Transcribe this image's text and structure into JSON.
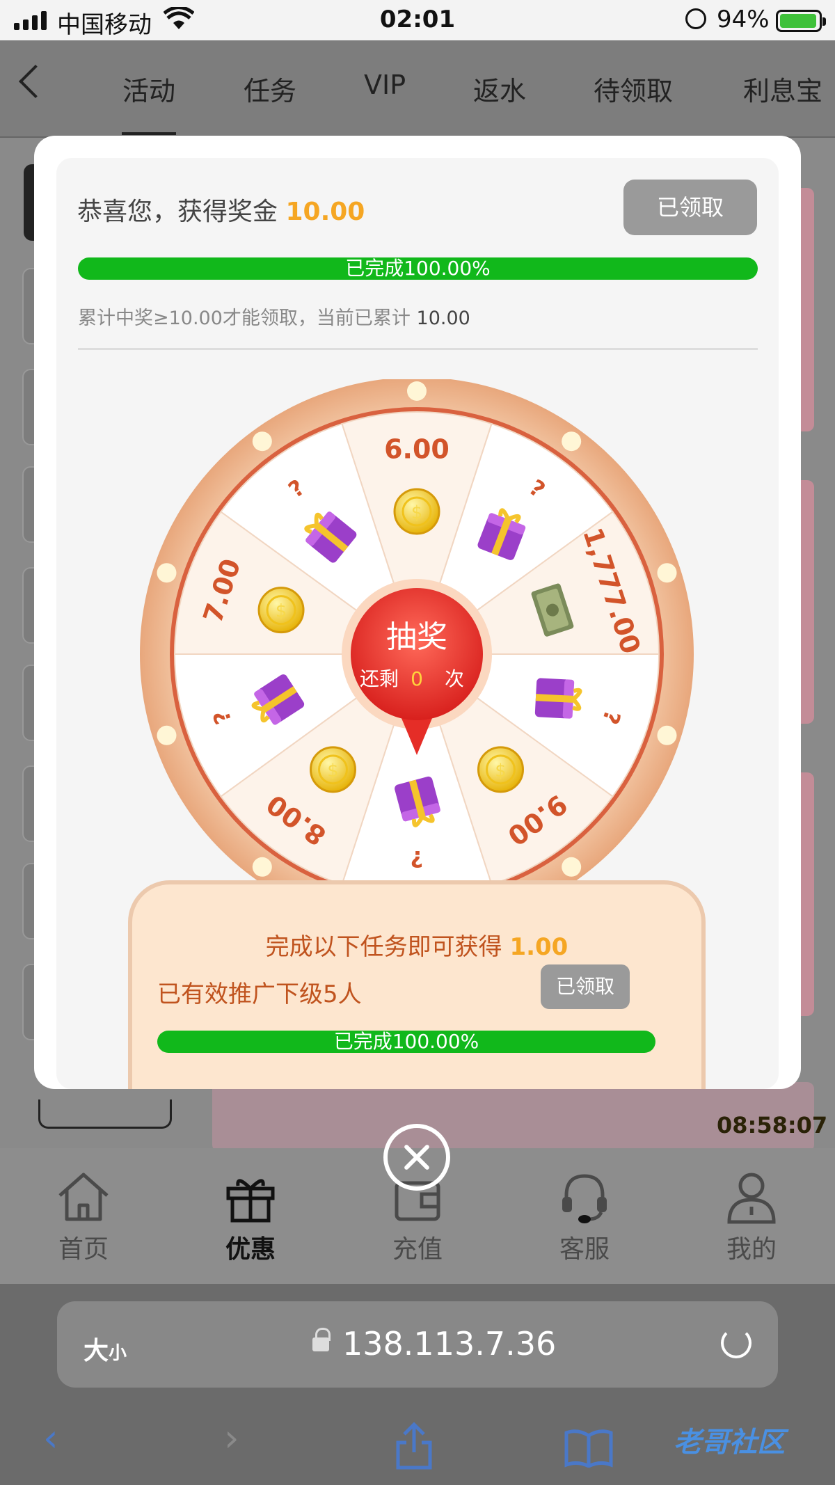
{
  "status_bar": {
    "carrier": "中国移动",
    "time": "02:01",
    "battery": "94%"
  },
  "top_tabs": {
    "items": [
      "活动",
      "任务",
      "VIP",
      "返水",
      "待领取",
      "利息宝"
    ],
    "active": "活动"
  },
  "background": {
    "countdown": "08:58:07"
  },
  "modal": {
    "reward_prefix": "恭喜您，获得奖金",
    "reward_amount": "10.00",
    "claim_button": "已领取",
    "progress_text": "已完成100.00%",
    "progress_fraction": 1.0,
    "accum_text": "累计中奖≥10.00才能领取，当前已累计",
    "accum_value": "10.00",
    "wheel": {
      "center_title": "抽奖",
      "remaining_prefix": "还剩",
      "remaining_count": "0",
      "remaining_suffix": "次",
      "segments": [
        "6.00",
        "?",
        "1,777.00",
        "?",
        "9.00",
        "?",
        "8.00",
        "?",
        "7.00",
        "?"
      ]
    },
    "task_panel": {
      "title_prefix": "完成以下任务即可获得",
      "title_amount": "1.00",
      "task_label": "已有效推广下级5人",
      "task_button": "已领取",
      "progress_text": "已完成100.00%",
      "progress_fraction": 1.0
    }
  },
  "bottom_nav": [
    {
      "label": "首页",
      "icon": "home-icon"
    },
    {
      "label": "优惠",
      "icon": "gift-icon",
      "active": true
    },
    {
      "label": "充值",
      "icon": "wallet-icon"
    },
    {
      "label": "客服",
      "icon": "headset-icon"
    },
    {
      "label": "我的",
      "icon": "user-icon"
    }
  ],
  "safari": {
    "text_size": "大",
    "text_size_small": "小",
    "url": "138.113.7.36",
    "watermark": "老哥社区"
  },
  "colors": {
    "accent_orange": "#f5a623",
    "progress_green": "#11b81b",
    "wheel_red": "#e52d27"
  }
}
